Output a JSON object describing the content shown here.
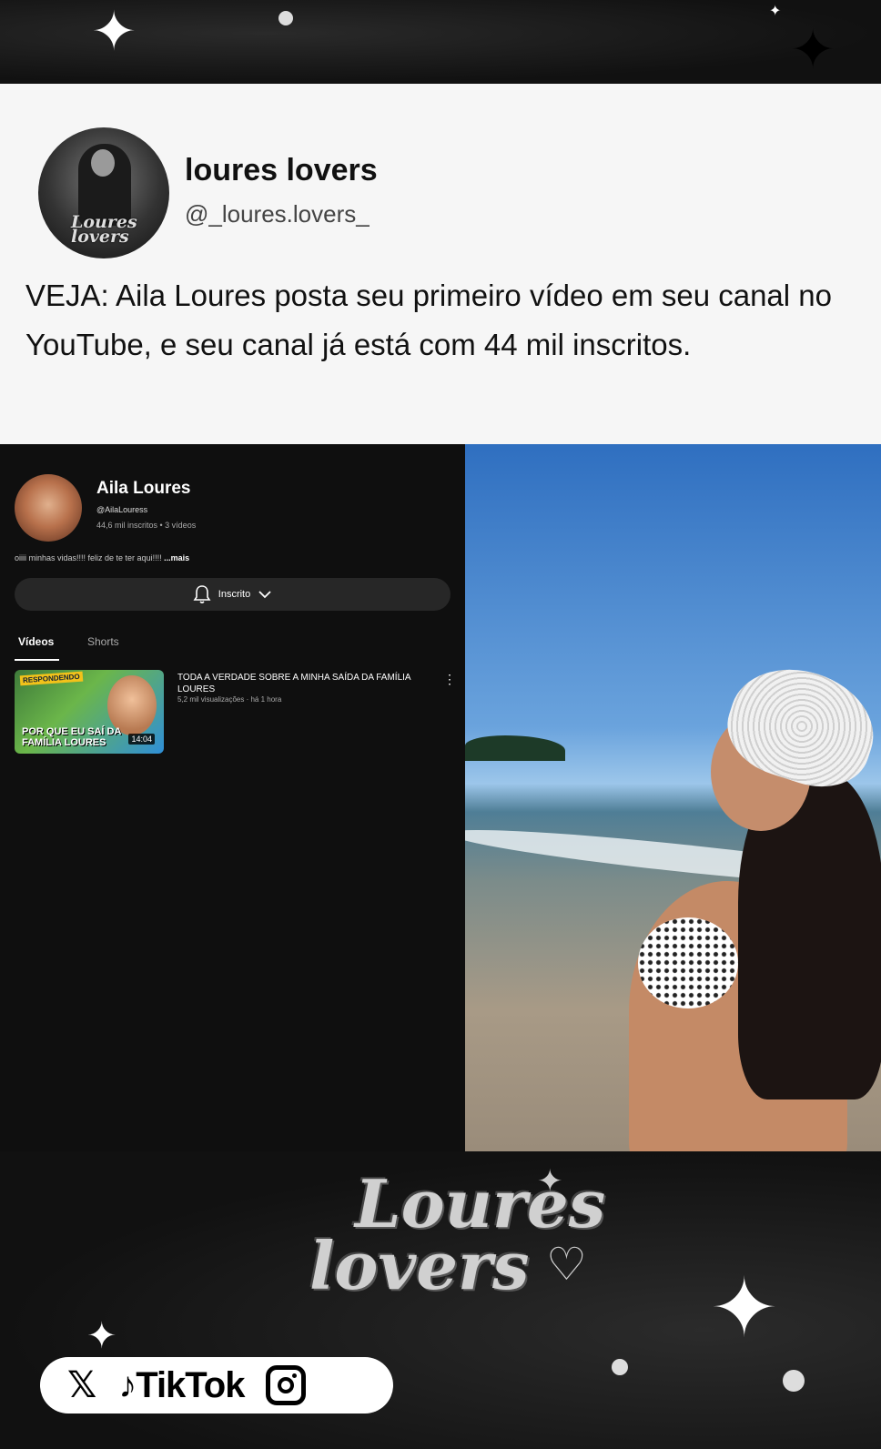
{
  "post": {
    "account_name": "loures lovers",
    "account_handle": "@_loures.lovers_",
    "text": "VEJA:  Aila Loures posta seu primeiro vídeo em seu canal no YouTube, e seu canal já está com 44 mil inscritos."
  },
  "youtube": {
    "channel_name": "Aila Loures",
    "channel_handle": "@AilaLouress",
    "stats": "44,6 mil inscritos  •  3 vídeos",
    "description": "oiiii minhas vidas!!!! feliz de te ter aqui!!!! ",
    "description_more": "...mais",
    "subscribe_label": "Inscrito",
    "tabs": [
      "Vídeos",
      "Shorts"
    ],
    "video": {
      "title": "TODA A VERDADE SOBRE A MINHA SAÍDA DA FAMÍLIA LOURES",
      "meta": "5,2 mil visualizações · há 1 hora",
      "duration": "14:04",
      "thumb_banner": "RESPONDENDO",
      "thumb_caption": "POR QUE EU SAÍ DA FAMÍLIA LOURES"
    }
  },
  "watermark": {
    "logo_line1": "Loures",
    "logo_line2": "lovers"
  },
  "social": {
    "x_icon": "x-logo-icon",
    "tiktok_label": "TikTok",
    "instagram_icon": "instagram-icon"
  }
}
